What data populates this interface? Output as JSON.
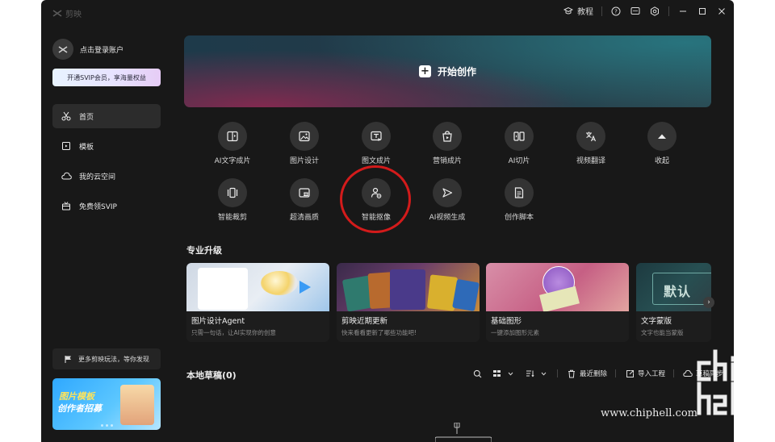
{
  "app": {
    "name": "剪映"
  },
  "titlebar": {
    "tutorial": "教程"
  },
  "sidebar": {
    "account": "点击登录账户",
    "svip_button": "开通SVIP会员，享海量权益",
    "nav": [
      {
        "label": "首页",
        "icon": "scissors-icon"
      },
      {
        "label": "模板",
        "icon": "template-icon"
      },
      {
        "label": "我的云空间",
        "icon": "cloud-icon"
      },
      {
        "label": "免费领SVIP",
        "icon": "gift-icon"
      }
    ],
    "promo_link": "更多剪映玩法，等你发现",
    "banner": {
      "line1": "图片模板",
      "line2": "创作者招募"
    }
  },
  "main": {
    "hero_label": "开始创作",
    "tools": [
      {
        "label": "AI文字成片",
        "icon": "ai-text-video-icon"
      },
      {
        "label": "图片设计",
        "icon": "image-design-icon"
      },
      {
        "label": "图文成片",
        "icon": "image-text-video-icon"
      },
      {
        "label": "营销成片",
        "icon": "marketing-video-icon"
      },
      {
        "label": "AI切片",
        "icon": "ai-slice-icon"
      },
      {
        "label": "视频翻译",
        "icon": "translate-icon"
      },
      {
        "label": "收起",
        "icon": "collapse-icon"
      },
      {
        "label": "智能裁剪",
        "icon": "smart-crop-icon"
      },
      {
        "label": "超清画质",
        "icon": "hd-quality-icon"
      },
      {
        "label": "智能抠像",
        "icon": "smart-cutout-icon"
      },
      {
        "label": "AI视频生成",
        "icon": "ai-video-gen-icon"
      },
      {
        "label": "创作脚本",
        "icon": "script-icon"
      }
    ],
    "section_title": "专业升级",
    "cards": [
      {
        "title": "图片设计Agent",
        "subtitle": "只需一句话，让AI实现你的创意"
      },
      {
        "title": "剪映近期更新",
        "subtitle": "快来看看更新了哪些功能吧!"
      },
      {
        "title": "基础图形",
        "subtitle": "一键添加图形元素"
      },
      {
        "title": "文字蒙版",
        "subtitle": "文字也能当蒙版"
      }
    ],
    "drafts_title": "本地草稿(0)",
    "draft_tools": {
      "recent_delete": "最近删除",
      "import": "导入工程",
      "cloud": "草稿同步"
    }
  },
  "watermark": "www.chiphell.com"
}
